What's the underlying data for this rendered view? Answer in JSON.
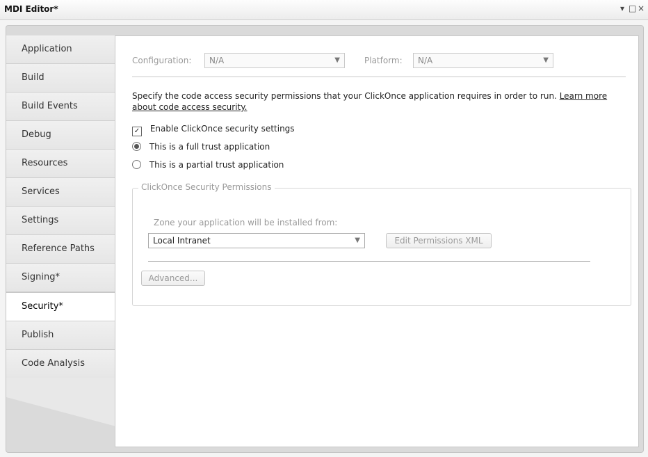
{
  "window": {
    "title": "MDI Editor*",
    "controls": [
      "▾",
      "□",
      "×"
    ]
  },
  "sidebar": {
    "items": [
      {
        "label": "Application"
      },
      {
        "label": "Build"
      },
      {
        "label": "Build Events"
      },
      {
        "label": "Debug"
      },
      {
        "label": "Resources"
      },
      {
        "label": "Services"
      },
      {
        "label": "Settings"
      },
      {
        "label": "Reference Paths"
      },
      {
        "label": "Signing*"
      },
      {
        "label": "Security*",
        "active": true
      },
      {
        "label": "Publish"
      },
      {
        "label": "Code Analysis"
      }
    ]
  },
  "config": {
    "configuration_label": "Configuration:",
    "configuration_value": "N/A",
    "platform_label": "Platform:",
    "platform_value": "N/A"
  },
  "security": {
    "description": "Specify the code access security permissions that your ClickOnce application requires in order to run.",
    "link": "Learn more about code access security.",
    "enable_checkbox_label": "Enable ClickOnce security settings",
    "enable_checked": true,
    "full_trust_label": "This is a full trust application",
    "partial_trust_label": "This is a partial trust application",
    "selected_trust": "full"
  },
  "permissions": {
    "group_title": "ClickOnce Security Permissions",
    "zone_label": "Zone your application will be installed from:",
    "zone_value": "Local Intranet",
    "edit_button": "Edit Permissions XML",
    "advanced_button": "Advanced..."
  },
  "colors": {
    "accent": "#ffffff",
    "sidebar": "#e8e8e8",
    "disabled_text": "#9a9a9a"
  },
  "icons": {
    "dropdown": "chevron-down-icon",
    "check": "check-icon"
  }
}
